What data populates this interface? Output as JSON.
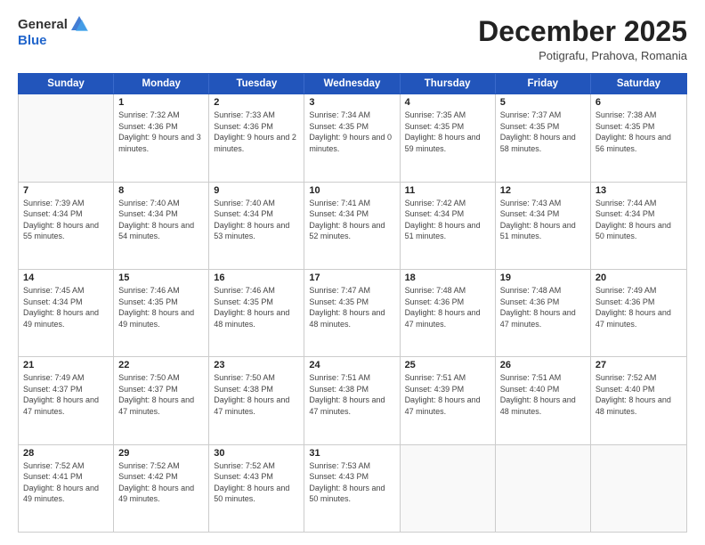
{
  "header": {
    "logo_general": "General",
    "logo_blue": "Blue",
    "month_title": "December 2025",
    "subtitle": "Potigrafu, Prahova, Romania"
  },
  "days_of_week": [
    "Sunday",
    "Monday",
    "Tuesday",
    "Wednesday",
    "Thursday",
    "Friday",
    "Saturday"
  ],
  "weeks": [
    [
      {
        "day": "",
        "empty": true
      },
      {
        "day": "1",
        "sunrise": "Sunrise: 7:32 AM",
        "sunset": "Sunset: 4:36 PM",
        "daylight": "Daylight: 9 hours and 3 minutes."
      },
      {
        "day": "2",
        "sunrise": "Sunrise: 7:33 AM",
        "sunset": "Sunset: 4:36 PM",
        "daylight": "Daylight: 9 hours and 2 minutes."
      },
      {
        "day": "3",
        "sunrise": "Sunrise: 7:34 AM",
        "sunset": "Sunset: 4:35 PM",
        "daylight": "Daylight: 9 hours and 0 minutes."
      },
      {
        "day": "4",
        "sunrise": "Sunrise: 7:35 AM",
        "sunset": "Sunset: 4:35 PM",
        "daylight": "Daylight: 8 hours and 59 minutes."
      },
      {
        "day": "5",
        "sunrise": "Sunrise: 7:37 AM",
        "sunset": "Sunset: 4:35 PM",
        "daylight": "Daylight: 8 hours and 58 minutes."
      },
      {
        "day": "6",
        "sunrise": "Sunrise: 7:38 AM",
        "sunset": "Sunset: 4:35 PM",
        "daylight": "Daylight: 8 hours and 56 minutes."
      }
    ],
    [
      {
        "day": "7",
        "sunrise": "Sunrise: 7:39 AM",
        "sunset": "Sunset: 4:34 PM",
        "daylight": "Daylight: 8 hours and 55 minutes."
      },
      {
        "day": "8",
        "sunrise": "Sunrise: 7:40 AM",
        "sunset": "Sunset: 4:34 PM",
        "daylight": "Daylight: 8 hours and 54 minutes."
      },
      {
        "day": "9",
        "sunrise": "Sunrise: 7:40 AM",
        "sunset": "Sunset: 4:34 PM",
        "daylight": "Daylight: 8 hours and 53 minutes."
      },
      {
        "day": "10",
        "sunrise": "Sunrise: 7:41 AM",
        "sunset": "Sunset: 4:34 PM",
        "daylight": "Daylight: 8 hours and 52 minutes."
      },
      {
        "day": "11",
        "sunrise": "Sunrise: 7:42 AM",
        "sunset": "Sunset: 4:34 PM",
        "daylight": "Daylight: 8 hours and 51 minutes."
      },
      {
        "day": "12",
        "sunrise": "Sunrise: 7:43 AM",
        "sunset": "Sunset: 4:34 PM",
        "daylight": "Daylight: 8 hours and 51 minutes."
      },
      {
        "day": "13",
        "sunrise": "Sunrise: 7:44 AM",
        "sunset": "Sunset: 4:34 PM",
        "daylight": "Daylight: 8 hours and 50 minutes."
      }
    ],
    [
      {
        "day": "14",
        "sunrise": "Sunrise: 7:45 AM",
        "sunset": "Sunset: 4:34 PM",
        "daylight": "Daylight: 8 hours and 49 minutes."
      },
      {
        "day": "15",
        "sunrise": "Sunrise: 7:46 AM",
        "sunset": "Sunset: 4:35 PM",
        "daylight": "Daylight: 8 hours and 49 minutes."
      },
      {
        "day": "16",
        "sunrise": "Sunrise: 7:46 AM",
        "sunset": "Sunset: 4:35 PM",
        "daylight": "Daylight: 8 hours and 48 minutes."
      },
      {
        "day": "17",
        "sunrise": "Sunrise: 7:47 AM",
        "sunset": "Sunset: 4:35 PM",
        "daylight": "Daylight: 8 hours and 48 minutes."
      },
      {
        "day": "18",
        "sunrise": "Sunrise: 7:48 AM",
        "sunset": "Sunset: 4:36 PM",
        "daylight": "Daylight: 8 hours and 47 minutes."
      },
      {
        "day": "19",
        "sunrise": "Sunrise: 7:48 AM",
        "sunset": "Sunset: 4:36 PM",
        "daylight": "Daylight: 8 hours and 47 minutes."
      },
      {
        "day": "20",
        "sunrise": "Sunrise: 7:49 AM",
        "sunset": "Sunset: 4:36 PM",
        "daylight": "Daylight: 8 hours and 47 minutes."
      }
    ],
    [
      {
        "day": "21",
        "sunrise": "Sunrise: 7:49 AM",
        "sunset": "Sunset: 4:37 PM",
        "daylight": "Daylight: 8 hours and 47 minutes."
      },
      {
        "day": "22",
        "sunrise": "Sunrise: 7:50 AM",
        "sunset": "Sunset: 4:37 PM",
        "daylight": "Daylight: 8 hours and 47 minutes."
      },
      {
        "day": "23",
        "sunrise": "Sunrise: 7:50 AM",
        "sunset": "Sunset: 4:38 PM",
        "daylight": "Daylight: 8 hours and 47 minutes."
      },
      {
        "day": "24",
        "sunrise": "Sunrise: 7:51 AM",
        "sunset": "Sunset: 4:38 PM",
        "daylight": "Daylight: 8 hours and 47 minutes."
      },
      {
        "day": "25",
        "sunrise": "Sunrise: 7:51 AM",
        "sunset": "Sunset: 4:39 PM",
        "daylight": "Daylight: 8 hours and 47 minutes."
      },
      {
        "day": "26",
        "sunrise": "Sunrise: 7:51 AM",
        "sunset": "Sunset: 4:40 PM",
        "daylight": "Daylight: 8 hours and 48 minutes."
      },
      {
        "day": "27",
        "sunrise": "Sunrise: 7:52 AM",
        "sunset": "Sunset: 4:40 PM",
        "daylight": "Daylight: 8 hours and 48 minutes."
      }
    ],
    [
      {
        "day": "28",
        "sunrise": "Sunrise: 7:52 AM",
        "sunset": "Sunset: 4:41 PM",
        "daylight": "Daylight: 8 hours and 49 minutes."
      },
      {
        "day": "29",
        "sunrise": "Sunrise: 7:52 AM",
        "sunset": "Sunset: 4:42 PM",
        "daylight": "Daylight: 8 hours and 49 minutes."
      },
      {
        "day": "30",
        "sunrise": "Sunrise: 7:52 AM",
        "sunset": "Sunset: 4:43 PM",
        "daylight": "Daylight: 8 hours and 50 minutes."
      },
      {
        "day": "31",
        "sunrise": "Sunrise: 7:53 AM",
        "sunset": "Sunset: 4:43 PM",
        "daylight": "Daylight: 8 hours and 50 minutes."
      },
      {
        "day": "",
        "empty": true
      },
      {
        "day": "",
        "empty": true
      },
      {
        "day": "",
        "empty": true
      }
    ]
  ]
}
